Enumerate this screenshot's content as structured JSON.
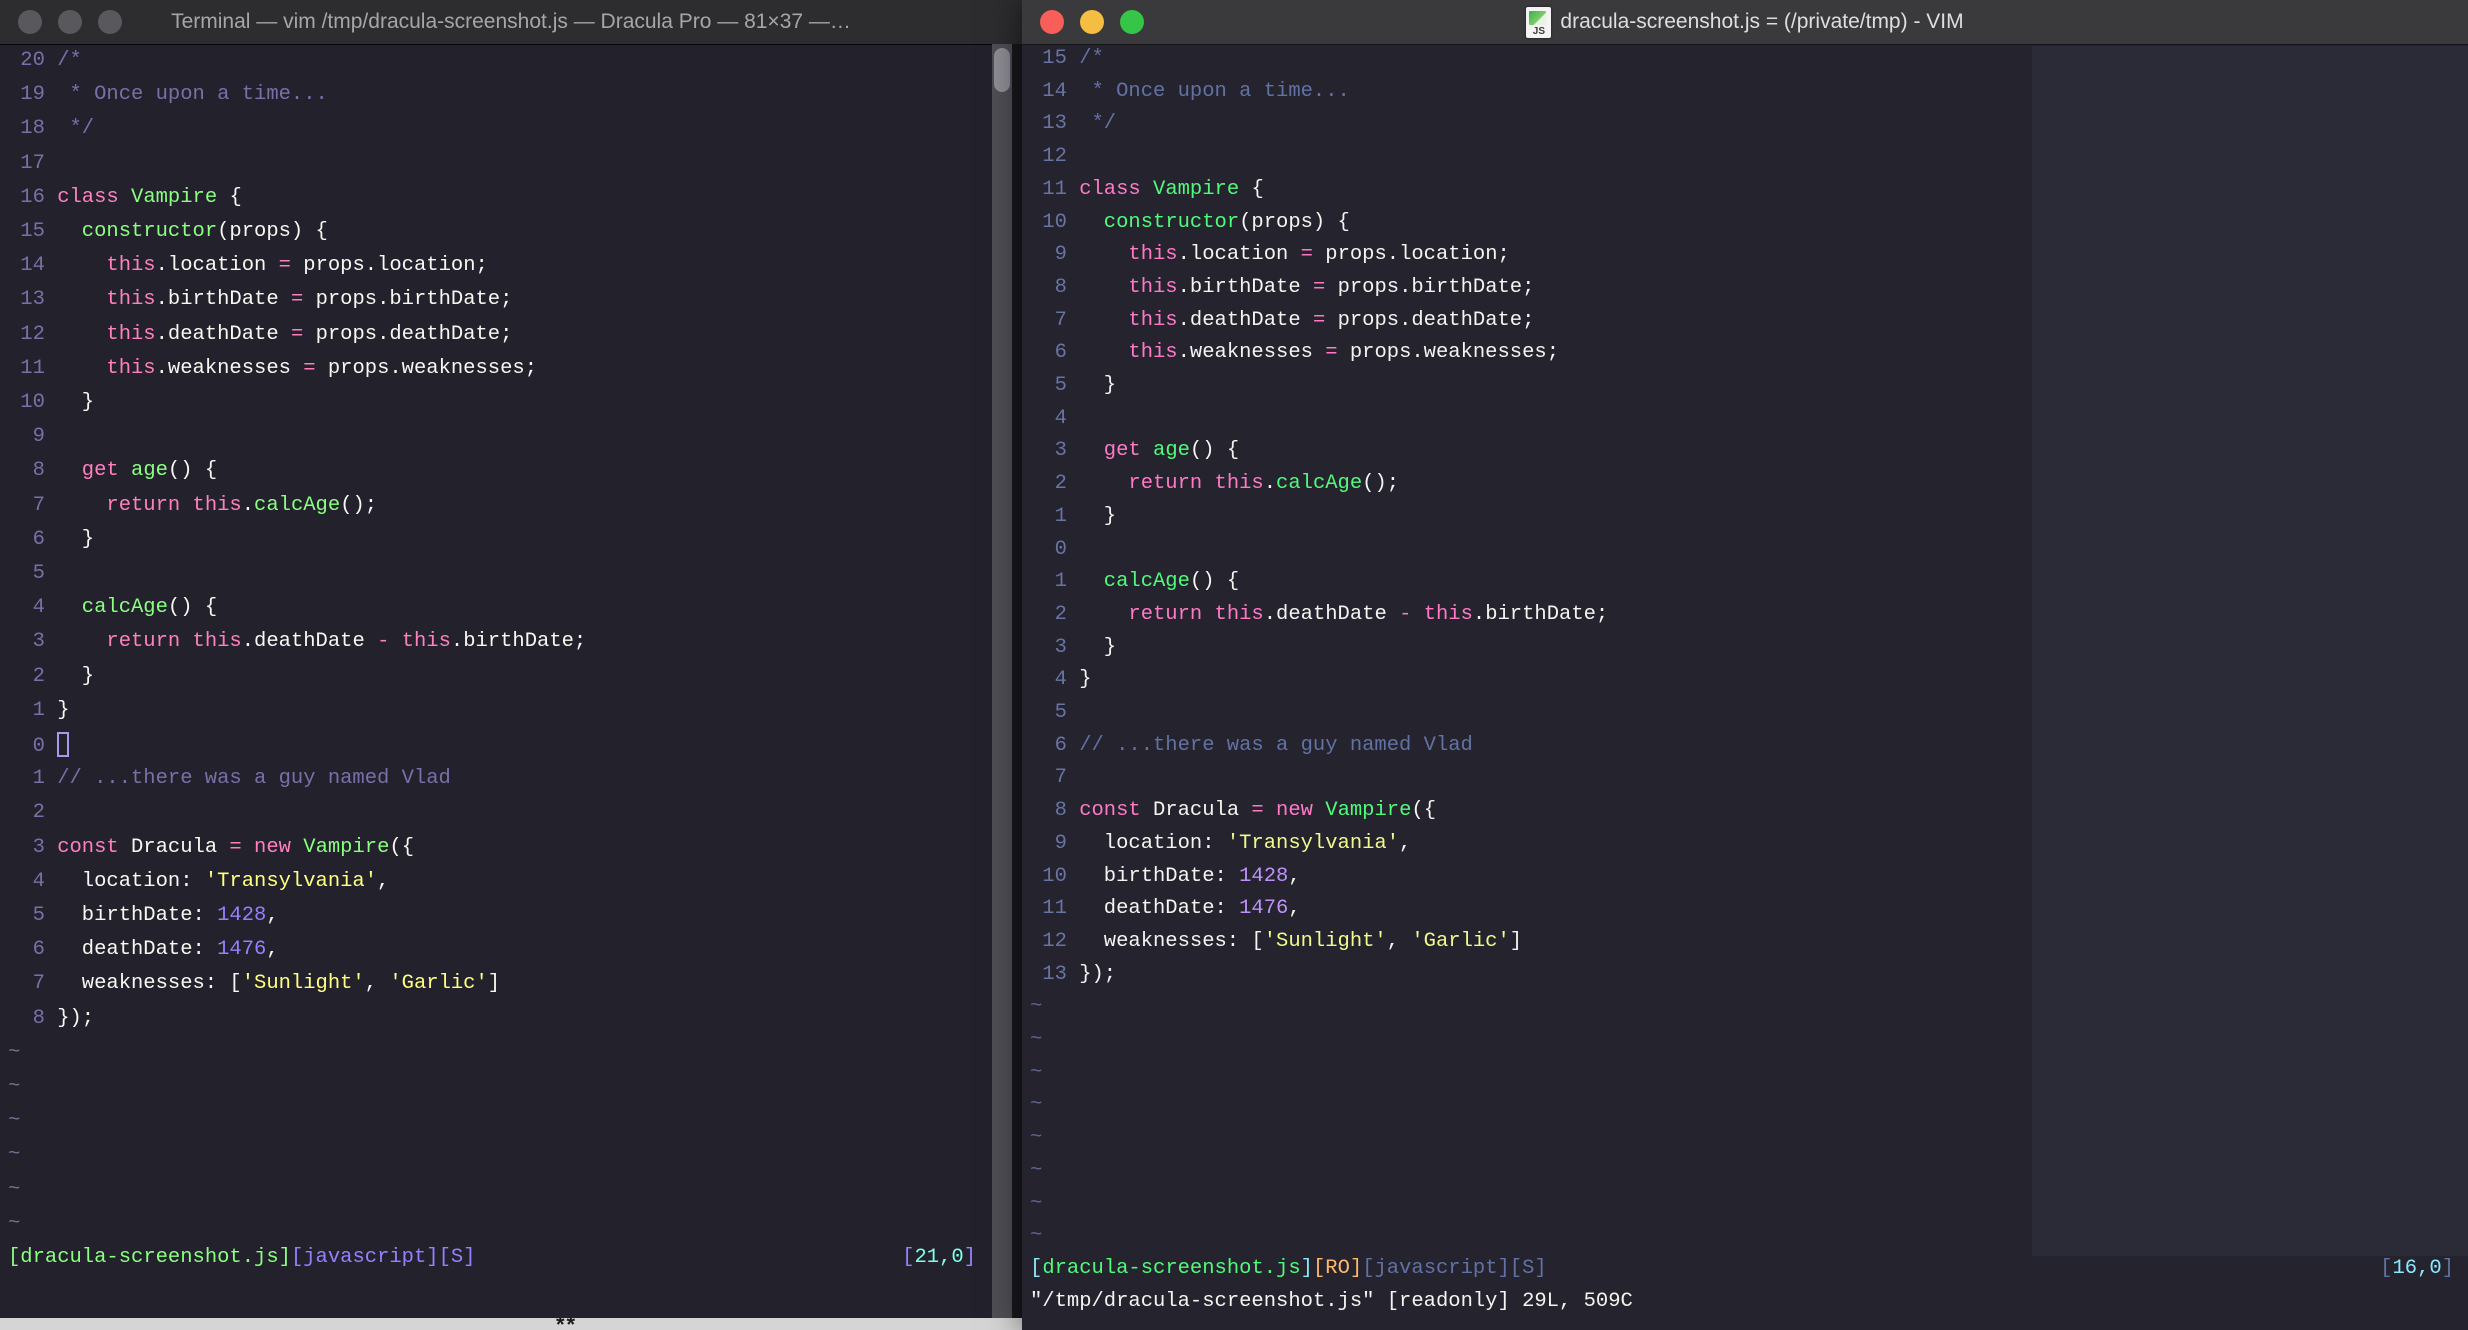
{
  "background_strip": {
    "mark": "**"
  },
  "left_window": {
    "title": "Terminal — vim /tmp/dracula-screenshot.js — Dracula Pro — 81×37 —…",
    "traffic_lights": [
      "close",
      "minimize",
      "zoom"
    ],
    "traffic_light_color": "#59585C",
    "theme": "Dracula Pro",
    "palette": {
      "f": "#F8F8F2",
      "c": "#7970A9",
      "n": "#7970A9",
      "p": "#FF80BF",
      "g": "#8AFF80",
      "y": "#FFFF80",
      "u": "#9580FF",
      "cy": "#80FFEA",
      "t": "#756F96",
      "bg": "#22212C"
    },
    "cursor_style": "hollow",
    "tildes": 6,
    "lines": [
      {
        "n": "20",
        "s": [
          [
            "c",
            "/*"
          ]
        ]
      },
      {
        "n": "19",
        "s": [
          [
            "c",
            " * Once upon a time..."
          ]
        ]
      },
      {
        "n": "18",
        "s": [
          [
            "c",
            " */"
          ]
        ]
      },
      {
        "n": "17",
        "s": []
      },
      {
        "n": "16",
        "s": [
          [
            "p",
            "class"
          ],
          [
            "f",
            " "
          ],
          [
            "g",
            "Vampire"
          ],
          [
            "f",
            " {"
          ]
        ]
      },
      {
        "n": "15",
        "s": [
          [
            "f",
            "  "
          ],
          [
            "g",
            "constructor"
          ],
          [
            "f",
            "(props) {"
          ]
        ]
      },
      {
        "n": "14",
        "s": [
          [
            "f",
            "    "
          ],
          [
            "p",
            "this"
          ],
          [
            "f",
            ".location "
          ],
          [
            "p",
            "="
          ],
          [
            "f",
            " props.location;"
          ]
        ]
      },
      {
        "n": "13",
        "s": [
          [
            "f",
            "    "
          ],
          [
            "p",
            "this"
          ],
          [
            "f",
            ".birthDate "
          ],
          [
            "p",
            "="
          ],
          [
            "f",
            " props.birthDate;"
          ]
        ]
      },
      {
        "n": "12",
        "s": [
          [
            "f",
            "    "
          ],
          [
            "p",
            "this"
          ],
          [
            "f",
            ".deathDate "
          ],
          [
            "p",
            "="
          ],
          [
            "f",
            " props.deathDate;"
          ]
        ]
      },
      {
        "n": "11",
        "s": [
          [
            "f",
            "    "
          ],
          [
            "p",
            "this"
          ],
          [
            "f",
            ".weaknesses "
          ],
          [
            "p",
            "="
          ],
          [
            "f",
            " props.weaknesses;"
          ]
        ]
      },
      {
        "n": "10",
        "s": [
          [
            "f",
            "  }"
          ]
        ]
      },
      {
        "n": "9",
        "s": []
      },
      {
        "n": "8",
        "s": [
          [
            "f",
            "  "
          ],
          [
            "p",
            "get"
          ],
          [
            "f",
            " "
          ],
          [
            "g",
            "age"
          ],
          [
            "f",
            "() {"
          ]
        ]
      },
      {
        "n": "7",
        "s": [
          [
            "f",
            "    "
          ],
          [
            "p",
            "return this"
          ],
          [
            "f",
            "."
          ],
          [
            "g",
            "calcAge"
          ],
          [
            "f",
            "();"
          ]
        ]
      },
      {
        "n": "6",
        "s": [
          [
            "f",
            "  }"
          ]
        ]
      },
      {
        "n": "5",
        "s": []
      },
      {
        "n": "4",
        "s": [
          [
            "f",
            "  "
          ],
          [
            "g",
            "calcAge"
          ],
          [
            "f",
            "() {"
          ]
        ]
      },
      {
        "n": "3",
        "s": [
          [
            "f",
            "    "
          ],
          [
            "p",
            "return this"
          ],
          [
            "f",
            ".deathDate "
          ],
          [
            "p",
            "-"
          ],
          [
            "f",
            " "
          ],
          [
            "p",
            "this"
          ],
          [
            "f",
            ".birthDate;"
          ]
        ]
      },
      {
        "n": "2",
        "s": [
          [
            "f",
            "  }"
          ]
        ]
      },
      {
        "n": "1",
        "s": [
          [
            "f",
            "}"
          ]
        ]
      },
      {
        "n": "0",
        "s": [],
        "cur": true
      },
      {
        "n": "1",
        "s": [
          [
            "c",
            "// ...there was a guy named Vlad"
          ]
        ]
      },
      {
        "n": "2",
        "s": []
      },
      {
        "n": "3",
        "s": [
          [
            "p",
            "const"
          ],
          [
            "f",
            " Dracula "
          ],
          [
            "p",
            "="
          ],
          [
            "f",
            " "
          ],
          [
            "p",
            "new"
          ],
          [
            "f",
            " "
          ],
          [
            "g",
            "Vampire"
          ],
          [
            "f",
            "({"
          ]
        ]
      },
      {
        "n": "4",
        "s": [
          [
            "f",
            "  location: "
          ],
          [
            "y",
            "'Transylvania'"
          ],
          [
            "f",
            ","
          ]
        ]
      },
      {
        "n": "5",
        "s": [
          [
            "f",
            "  birthDate: "
          ],
          [
            "u",
            "1428"
          ],
          [
            "f",
            ","
          ]
        ]
      },
      {
        "n": "6",
        "s": [
          [
            "f",
            "  deathDate: "
          ],
          [
            "u",
            "1476"
          ],
          [
            "f",
            ","
          ]
        ]
      },
      {
        "n": "7",
        "s": [
          [
            "f",
            "  weaknesses: ["
          ],
          [
            "y",
            "'Sunlight'"
          ],
          [
            "f",
            ", "
          ],
          [
            "y",
            "'Garlic'"
          ],
          [
            "f",
            "]"
          ]
        ]
      },
      {
        "n": "8",
        "s": [
          [
            "f",
            "});"
          ]
        ]
      }
    ],
    "statusline": [
      [
        "g",
        "[dracula-screenshot.js]"
      ],
      [
        "u",
        "[javascript][S]"
      ]
    ],
    "ruler": [
      [
        "u",
        "["
      ],
      [
        "cy",
        "21,0"
      ],
      [
        "u",
        "]"
      ]
    ]
  },
  "right_window": {
    "title": "dracula-screenshot.js = (/private/tmp) - VIM",
    "icon": "js-file-icon",
    "icon_label": "JS",
    "traffic_lights": [
      "close",
      "minimize",
      "zoom"
    ],
    "traffic_light_colors": [
      "#F75F58",
      "#F5BD41",
      "#36C647"
    ],
    "theme": "Dracula",
    "palette": {
      "f": "#F4F4F0",
      "c": "#6272A4",
      "n": "#6874A3",
      "p": "#FF79C6",
      "g": "#50FA7B",
      "y": "#F1FA8C",
      "u": "#BD93F9",
      "cy": "#8BE9FD",
      "o": "#FFB86C",
      "m": "#6272A4",
      "t": "#5C668F",
      "bg": "#24232E"
    },
    "cursor_style": "none",
    "tildes": 8,
    "lines": [
      {
        "n": "15",
        "s": [
          [
            "c",
            "/*"
          ]
        ]
      },
      {
        "n": "14",
        "s": [
          [
            "c",
            " * Once upon a time..."
          ]
        ]
      },
      {
        "n": "13",
        "s": [
          [
            "c",
            " */"
          ]
        ]
      },
      {
        "n": "12",
        "s": []
      },
      {
        "n": "11",
        "s": [
          [
            "p",
            "class"
          ],
          [
            "f",
            " "
          ],
          [
            "g",
            "Vampire"
          ],
          [
            "f",
            " {"
          ]
        ]
      },
      {
        "n": "10",
        "s": [
          [
            "f",
            "  "
          ],
          [
            "g",
            "constructor"
          ],
          [
            "f",
            "(props) {"
          ]
        ]
      },
      {
        "n": "9",
        "s": [
          [
            "f",
            "    "
          ],
          [
            "p",
            "this"
          ],
          [
            "f",
            ".location "
          ],
          [
            "p",
            "="
          ],
          [
            "f",
            " props.location;"
          ]
        ]
      },
      {
        "n": "8",
        "s": [
          [
            "f",
            "    "
          ],
          [
            "p",
            "this"
          ],
          [
            "f",
            ".birthDate "
          ],
          [
            "p",
            "="
          ],
          [
            "f",
            " props.birthDate;"
          ]
        ]
      },
      {
        "n": "7",
        "s": [
          [
            "f",
            "    "
          ],
          [
            "p",
            "this"
          ],
          [
            "f",
            ".deathDate "
          ],
          [
            "p",
            "="
          ],
          [
            "f",
            " props.deathDate;"
          ]
        ]
      },
      {
        "n": "6",
        "s": [
          [
            "f",
            "    "
          ],
          [
            "p",
            "this"
          ],
          [
            "f",
            ".weaknesses "
          ],
          [
            "p",
            "="
          ],
          [
            "f",
            " props.weaknesses;"
          ]
        ]
      },
      {
        "n": "5",
        "s": [
          [
            "f",
            "  }"
          ]
        ]
      },
      {
        "n": "4",
        "s": []
      },
      {
        "n": "3",
        "s": [
          [
            "f",
            "  "
          ],
          [
            "p",
            "get"
          ],
          [
            "f",
            " "
          ],
          [
            "g",
            "age"
          ],
          [
            "f",
            "() {"
          ]
        ]
      },
      {
        "n": "2",
        "s": [
          [
            "f",
            "    "
          ],
          [
            "p",
            "return this"
          ],
          [
            "f",
            "."
          ],
          [
            "g",
            "calcAge"
          ],
          [
            "f",
            "();"
          ]
        ]
      },
      {
        "n": "1",
        "s": [
          [
            "f",
            "  }"
          ]
        ]
      },
      {
        "n": "0",
        "s": [],
        "cur": true
      },
      {
        "n": "1",
        "s": [
          [
            "f",
            "  "
          ],
          [
            "g",
            "calcAge"
          ],
          [
            "f",
            "() {"
          ]
        ]
      },
      {
        "n": "2",
        "s": [
          [
            "f",
            "    "
          ],
          [
            "p",
            "return this"
          ],
          [
            "f",
            ".deathDate "
          ],
          [
            "p",
            "-"
          ],
          [
            "f",
            " "
          ],
          [
            "p",
            "this"
          ],
          [
            "f",
            ".birthDate;"
          ]
        ]
      },
      {
        "n": "3",
        "s": [
          [
            "f",
            "  }"
          ]
        ]
      },
      {
        "n": "4",
        "s": [
          [
            "f",
            "}"
          ]
        ]
      },
      {
        "n": "5",
        "s": []
      },
      {
        "n": "6",
        "s": [
          [
            "c",
            "// ...there was a guy named Vlad"
          ]
        ]
      },
      {
        "n": "7",
        "s": []
      },
      {
        "n": "8",
        "s": [
          [
            "p",
            "const"
          ],
          [
            "f",
            " Dracula "
          ],
          [
            "p",
            "="
          ],
          [
            "f",
            " "
          ],
          [
            "p",
            "new"
          ],
          [
            "f",
            " "
          ],
          [
            "g",
            "Vampire"
          ],
          [
            "f",
            "({"
          ]
        ]
      },
      {
        "n": "9",
        "s": [
          [
            "f",
            "  location: "
          ],
          [
            "y",
            "'Transylvania'"
          ],
          [
            "f",
            ","
          ]
        ]
      },
      {
        "n": "10",
        "s": [
          [
            "f",
            "  birthDate: "
          ],
          [
            "u",
            "1428"
          ],
          [
            "f",
            ","
          ]
        ]
      },
      {
        "n": "11",
        "s": [
          [
            "f",
            "  deathDate: "
          ],
          [
            "u",
            "1476"
          ],
          [
            "f",
            ","
          ]
        ]
      },
      {
        "n": "12",
        "s": [
          [
            "f",
            "  weaknesses: ["
          ],
          [
            "y",
            "'Sunlight'"
          ],
          [
            "f",
            ", "
          ],
          [
            "y",
            "'Garlic'"
          ],
          [
            "f",
            "]"
          ]
        ]
      },
      {
        "n": "13",
        "s": [
          [
            "f",
            "});"
          ]
        ]
      }
    ],
    "statusline": [
      [
        "cy",
        "["
      ],
      [
        "g",
        "dracula-screenshot.js"
      ],
      [
        "cy",
        "]"
      ],
      [
        "o",
        "[RO]"
      ],
      [
        "m",
        "[javascript][S]"
      ]
    ],
    "ruler": [
      [
        "m",
        "["
      ],
      [
        "cy",
        "16,0"
      ],
      [
        "m",
        "]"
      ]
    ],
    "cmdline": "\"/tmp/dracula-screenshot.js\" [readonly] 29L, 509C"
  }
}
